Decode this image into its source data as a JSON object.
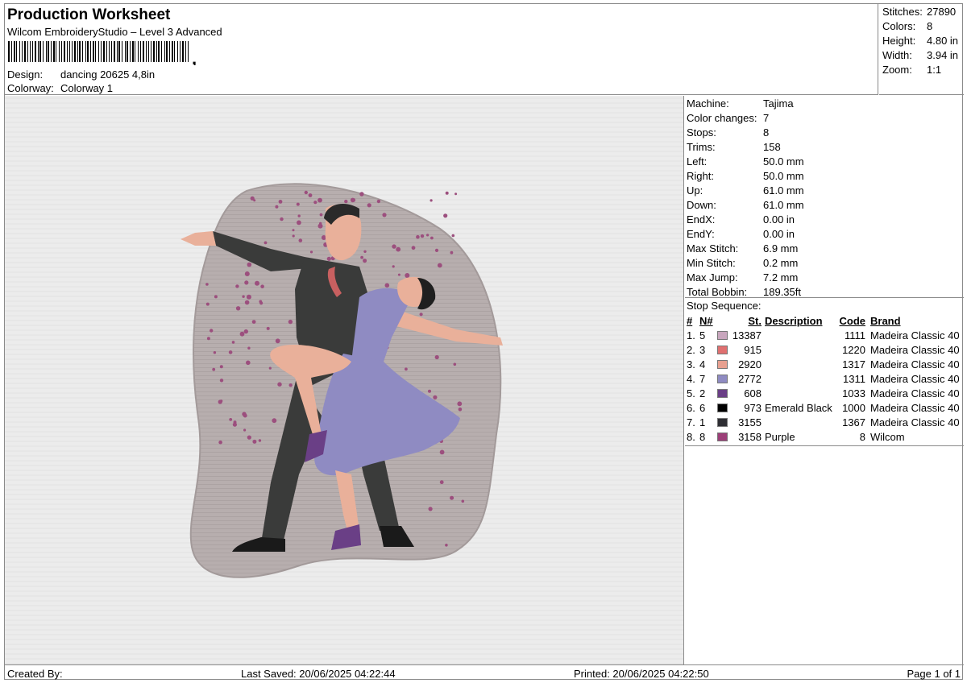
{
  "header": {
    "title": "Production Worksheet",
    "subtitle": "Wilcom EmbroideryStudio – Level 3 Advanced",
    "design_label": "Design:",
    "design_value": "dancing 20625 4,8in",
    "colorway_label": "Colorway:",
    "colorway_value": "Colorway 1"
  },
  "stats": [
    {
      "label": "Stitches:",
      "value": "27890"
    },
    {
      "label": "Colors:",
      "value": "8"
    },
    {
      "label": "Height:",
      "value": "4.80 in"
    },
    {
      "label": "Width:",
      "value": "3.94 in"
    },
    {
      "label": "Zoom:",
      "value": "1:1"
    }
  ],
  "machine": [
    {
      "label": "Machine:",
      "value": "Tajima"
    },
    {
      "label": "Color changes:",
      "value": "7"
    },
    {
      "label": "Stops:",
      "value": "8"
    },
    {
      "label": "Trims:",
      "value": "158"
    },
    {
      "label": "Left:",
      "value": "50.0 mm"
    },
    {
      "label": "Right:",
      "value": "50.0 mm"
    },
    {
      "label": "Up:",
      "value": "61.0 mm"
    },
    {
      "label": "Down:",
      "value": "61.0 mm"
    },
    {
      "label": "EndX:",
      "value": "0.00 in"
    },
    {
      "label": "EndY:",
      "value": "0.00 in"
    },
    {
      "label": "Max Stitch:",
      "value": "6.9 mm"
    },
    {
      "label": "Min Stitch:",
      "value": "0.2 mm"
    },
    {
      "label": "Max Jump:",
      "value": "7.2 mm"
    },
    {
      "label": "Total Bobbin:",
      "value": "189.35ft"
    }
  ],
  "stop_sequence": {
    "title": "Stop Sequence:",
    "headers": {
      "num": "#",
      "n": "N#",
      "st": "St.",
      "description": "Description",
      "code": "Code",
      "brand": "Brand"
    },
    "rows": [
      {
        "num": "1.",
        "n": "5",
        "color": "#c8a6bd",
        "st": "13387",
        "description": "",
        "code": "1111",
        "brand": "Madeira Classic 40"
      },
      {
        "num": "2.",
        "n": "3",
        "color": "#e07070",
        "st": "915",
        "description": "",
        "code": "1220",
        "brand": "Madeira Classic 40"
      },
      {
        "num": "3.",
        "n": "4",
        "color": "#e8a090",
        "st": "2920",
        "description": "",
        "code": "1317",
        "brand": "Madeira Classic 40"
      },
      {
        "num": "4.",
        "n": "7",
        "color": "#8f8bc2",
        "st": "2772",
        "description": "",
        "code": "1311",
        "brand": "Madeira Classic 40"
      },
      {
        "num": "5.",
        "n": "2",
        "color": "#6a3f86",
        "st": "608",
        "description": "",
        "code": "1033",
        "brand": "Madeira Classic 40"
      },
      {
        "num": "6.",
        "n": "6",
        "color": "#000000",
        "st": "973",
        "description": "Emerald Black",
        "code": "1000",
        "brand": "Madeira Classic 40"
      },
      {
        "num": "7.",
        "n": "1",
        "color": "#2e2e33",
        "st": "3155",
        "description": "",
        "code": "1367",
        "brand": "Madeira Classic 40"
      },
      {
        "num": "8.",
        "n": "8",
        "color": "#9c3f78",
        "st": "3158",
        "description": "Purple",
        "code": "8",
        "brand": "Wilcom"
      }
    ]
  },
  "footer": {
    "created_by": "Created By:",
    "last_saved": "Last Saved: 20/06/2025 04:22:44",
    "printed": "Printed: 20/06/2025 04:22:50",
    "page": "Page 1 of 1"
  }
}
